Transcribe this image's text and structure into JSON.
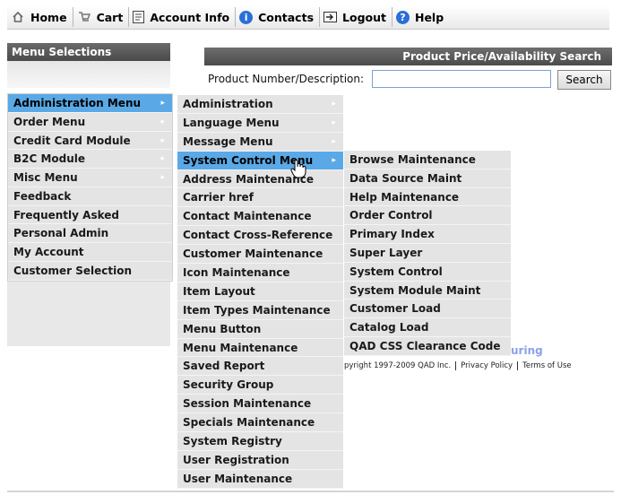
{
  "topnav": {
    "items": [
      {
        "label": "Home",
        "icon": "home-icon"
      },
      {
        "label": "Cart",
        "icon": "cart-icon"
      },
      {
        "label": "Account Info",
        "icon": "account-icon"
      },
      {
        "label": "Contacts",
        "icon": "info-icon"
      },
      {
        "label": "Logout",
        "icon": "logout-icon"
      },
      {
        "label": "Help",
        "icon": "help-icon"
      }
    ]
  },
  "sidebar": {
    "header": "Menu Selections",
    "items": [
      {
        "label": "Administration Menu",
        "active": true
      },
      {
        "label": "Order Menu"
      },
      {
        "label": "Credit Card Module"
      },
      {
        "label": "B2C Module"
      },
      {
        "label": "Misc Menu"
      },
      {
        "label": "Feedback"
      },
      {
        "label": "Frequently Asked"
      },
      {
        "label": "Personal Admin"
      },
      {
        "label": "My Account"
      },
      {
        "label": "Customer Selection"
      }
    ]
  },
  "search": {
    "header": "Product Price/Availability Search",
    "label": "Product Number/Description:",
    "value": "",
    "button": "Search"
  },
  "submenu1": {
    "items": [
      {
        "label": "Administration"
      },
      {
        "label": "Language Menu"
      },
      {
        "label": "Message Menu"
      },
      {
        "label": "System Control Menu",
        "active": true
      },
      {
        "label": "Address Maintenance"
      },
      {
        "label": "Carrier href"
      },
      {
        "label": "Contact Maintenance"
      },
      {
        "label": "Contact Cross-Reference"
      },
      {
        "label": "Customer Maintenance"
      },
      {
        "label": "Icon Maintenance"
      },
      {
        "label": "Item Layout"
      },
      {
        "label": "Item Types Maintenance"
      },
      {
        "label": "Menu Button"
      },
      {
        "label": "Menu Maintenance"
      },
      {
        "label": "Saved Report"
      },
      {
        "label": "Security Group"
      },
      {
        "label": "Session Maintenance"
      },
      {
        "label": "Specials Maintenance"
      },
      {
        "label": "System Registry"
      },
      {
        "label": "User Registration"
      },
      {
        "label": "User Maintenance"
      }
    ]
  },
  "submenu2": {
    "items": [
      {
        "label": "Browse Maintenance"
      },
      {
        "label": "Data Source Maint"
      },
      {
        "label": "Help Maintenance"
      },
      {
        "label": "Order Control"
      },
      {
        "label": "Primary Index"
      },
      {
        "label": "Super Layer"
      },
      {
        "label": "System Control"
      },
      {
        "label": "System Module Maint"
      },
      {
        "label": "Customer Load"
      },
      {
        "label": "Catalog Load"
      },
      {
        "label": "QAD CSS Clearance Code"
      }
    ]
  },
  "footer": {
    "brand_fragment": "uring",
    "copyright": "pyright 1997-2009 QAD Inc.",
    "privacy": "Privacy Policy",
    "terms": "Terms of Use"
  },
  "colors": {
    "active_item": "#5aa9e6",
    "menu_item_bg": "#e4e4e4",
    "header_bg": "#555555"
  }
}
